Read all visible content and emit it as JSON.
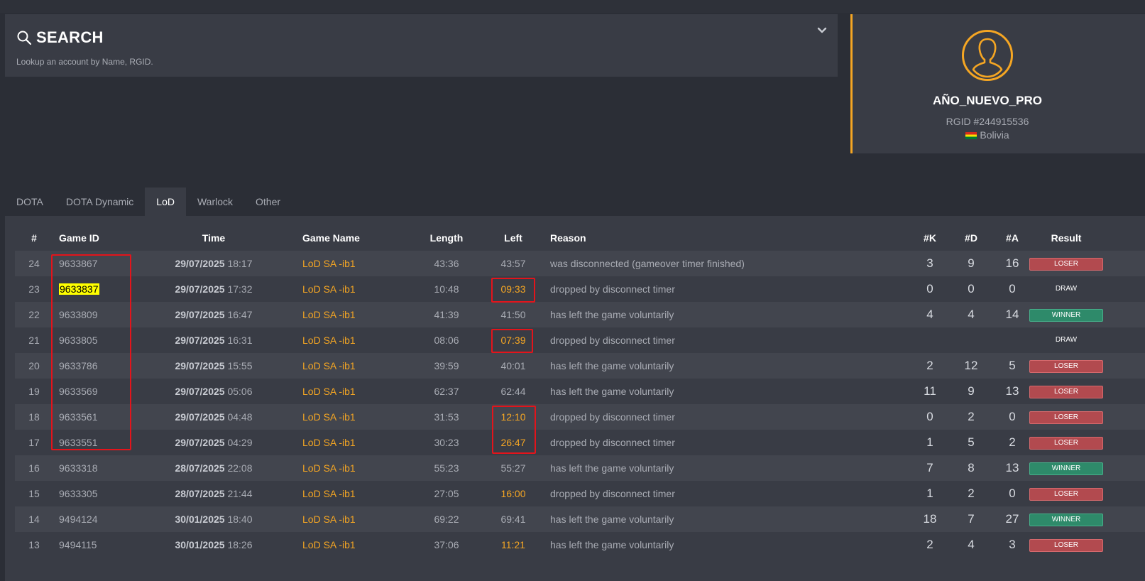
{
  "search": {
    "title": "SEARCH",
    "subtitle": "Lookup an account by Name, RGID."
  },
  "profile": {
    "name": "AÑO_NUEVO_PRO",
    "rgid": "RGID #244915536",
    "country": "Bolivia",
    "accent": "#f5a623"
  },
  "tabs": [
    {
      "label": "DOTA",
      "active": false
    },
    {
      "label": "DOTA Dynamic",
      "active": false
    },
    {
      "label": "LoD",
      "active": true
    },
    {
      "label": "Warlock",
      "active": false
    },
    {
      "label": "Other",
      "active": false
    }
  ],
  "table": {
    "headers": {
      "num": "#",
      "game_id": "Game ID",
      "time": "Time",
      "game_name": "Game Name",
      "length": "Length",
      "left": "Left",
      "reason": "Reason",
      "k": "#K",
      "d": "#D",
      "a": "#A",
      "result": "Result"
    },
    "rows": [
      {
        "num": "24",
        "game_id": "9633867",
        "date": "29/07/2025",
        "clock": "18:17",
        "game_name": "LoD SA -ib1",
        "length": "43:36",
        "left": "43:57",
        "reason": "was disconnected (gameover timer finished)",
        "k": "3",
        "d": "9",
        "a": "16",
        "result": "LOSER"
      },
      {
        "num": "23",
        "game_id": "9633837",
        "date": "29/07/2025",
        "clock": "17:32",
        "game_name": "LoD SA -ib1",
        "length": "10:48",
        "left": "09:33",
        "reason": "dropped by disconnect timer",
        "k": "0",
        "d": "0",
        "a": "0",
        "result": "DRAW"
      },
      {
        "num": "22",
        "game_id": "9633809",
        "date": "29/07/2025",
        "clock": "16:47",
        "game_name": "LoD SA -ib1",
        "length": "41:39",
        "left": "41:50",
        "reason": "has left the game voluntarily",
        "k": "4",
        "d": "4",
        "a": "14",
        "result": "WINNER"
      },
      {
        "num": "21",
        "game_id": "9633805",
        "date": "29/07/2025",
        "clock": "16:31",
        "game_name": "LoD SA -ib1",
        "length": "08:06",
        "left": "07:39",
        "reason": "dropped by disconnect timer",
        "k": "",
        "d": "",
        "a": "",
        "result": "DRAW"
      },
      {
        "num": "20",
        "game_id": "9633786",
        "date": "29/07/2025",
        "clock": "15:55",
        "game_name": "LoD SA -ib1",
        "length": "39:59",
        "left": "40:01",
        "reason": "has left the game voluntarily",
        "k": "2",
        "d": "12",
        "a": "5",
        "result": "LOSER"
      },
      {
        "num": "19",
        "game_id": "9633569",
        "date": "29/07/2025",
        "clock": "05:06",
        "game_name": "LoD SA -ib1",
        "length": "62:37",
        "left": "62:44",
        "reason": "has left the game voluntarily",
        "k": "11",
        "d": "9",
        "a": "13",
        "result": "LOSER"
      },
      {
        "num": "18",
        "game_id": "9633561",
        "date": "29/07/2025",
        "clock": "04:48",
        "game_name": "LoD SA -ib1",
        "length": "31:53",
        "left": "12:10",
        "reason": "dropped by disconnect timer",
        "k": "0",
        "d": "2",
        "a": "0",
        "result": "LOSER"
      },
      {
        "num": "17",
        "game_id": "9633551",
        "date": "29/07/2025",
        "clock": "04:29",
        "game_name": "LoD SA -ib1",
        "length": "30:23",
        "left": "26:47",
        "reason": "dropped by disconnect timer",
        "k": "1",
        "d": "5",
        "a": "2",
        "result": "LOSER"
      },
      {
        "num": "16",
        "game_id": "9633318",
        "date": "28/07/2025",
        "clock": "22:08",
        "game_name": "LoD SA -ib1",
        "length": "55:23",
        "left": "55:27",
        "reason": "has left the game voluntarily",
        "k": "7",
        "d": "8",
        "a": "13",
        "result": "WINNER"
      },
      {
        "num": "15",
        "game_id": "9633305",
        "date": "28/07/2025",
        "clock": "21:44",
        "game_name": "LoD SA -ib1",
        "length": "27:05",
        "left": "16:00",
        "reason": "dropped by disconnect timer",
        "k": "1",
        "d": "2",
        "a": "0",
        "result": "LOSER"
      },
      {
        "num": "14",
        "game_id": "9494124",
        "date": "30/01/2025",
        "clock": "18:40",
        "game_name": "LoD SA -ib1",
        "length": "69:22",
        "left": "69:41",
        "reason": "has left the game voluntarily",
        "k": "18",
        "d": "7",
        "a": "27",
        "result": "WINNER"
      },
      {
        "num": "13",
        "game_id": "9494115",
        "date": "30/01/2025",
        "clock": "18:26",
        "game_name": "LoD SA -ib1",
        "length": "37:06",
        "left": "11:21",
        "reason": "has left the game voluntarily",
        "k": "2",
        "d": "4",
        "a": "3",
        "result": "LOSER"
      }
    ]
  },
  "colors": {
    "background": "#2b2e36",
    "panel": "#393c45",
    "accent": "#f5a623",
    "loser": "#b24a4f",
    "winner": "#2e8a6a",
    "annotation": "#e3141b",
    "highlight": "#ffff00"
  }
}
